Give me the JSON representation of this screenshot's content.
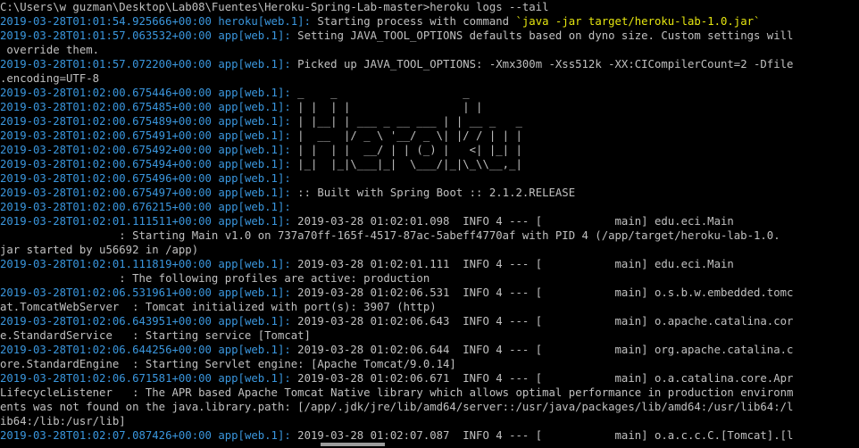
{
  "colors": {
    "background": "#000000",
    "text": "#c0c0c0",
    "timestamp": "#3a96dd",
    "highlight": "#e5e510"
  },
  "lines": [
    {
      "kind": "plain",
      "text": "C:\\Users\\w guzman\\Desktop\\Lab08\\Fuentes\\Heroku-Spring-Lab-master>heroku logs --tail"
    },
    {
      "kind": "log",
      "ts": "2019-03-28T01:01:54.925666+00:00",
      "src": " heroku[web.1]:",
      "msg": " Starting process with command ",
      "hl": "`java -jar target/heroku-lab-1.0.jar`"
    },
    {
      "kind": "log",
      "ts": "2019-03-28T01:01:57.063532+00:00",
      "src": " app[web.1]:",
      "msg": " Setting JAVA_TOOL_OPTIONS defaults based on dyno size. Custom settings will"
    },
    {
      "kind": "plain",
      "text": " override them."
    },
    {
      "kind": "log",
      "ts": "2019-03-28T01:01:57.072200+00:00",
      "src": " app[web.1]:",
      "msg": " Picked up JAVA_TOOL_OPTIONS: -Xmx300m -Xss512k -XX:CICompilerCount=2 -Dfile"
    },
    {
      "kind": "plain",
      "text": ".encoding=UTF-8"
    },
    {
      "kind": "log",
      "ts": "2019-03-28T01:02:00.675446+00:00",
      "src": " app[web.1]:",
      "msg": " _    _                   _"
    },
    {
      "kind": "log",
      "ts": "2019-03-28T01:02:00.675485+00:00",
      "src": " app[web.1]:",
      "msg": " | |  | |                 | |"
    },
    {
      "kind": "log",
      "ts": "2019-03-28T01:02:00.675489+00:00",
      "src": " app[web.1]:",
      "msg": " | |__| | ___ _ __ ___ | | __ _   _"
    },
    {
      "kind": "log",
      "ts": "2019-03-28T01:02:00.675491+00:00",
      "src": " app[web.1]:",
      "msg": " |  __  |/ _ \\ '__/ _ \\| |/ / | | |"
    },
    {
      "kind": "log",
      "ts": "2019-03-28T01:02:00.675492+00:00",
      "src": " app[web.1]:",
      "msg": " | |  | |  __/ | | (_) |   <| |_| |"
    },
    {
      "kind": "log",
      "ts": "2019-03-28T01:02:00.675494+00:00",
      "src": " app[web.1]:",
      "msg": " |_|  |_|\\___|_|  \\___/|_|\\_\\\\__,_|"
    },
    {
      "kind": "log",
      "ts": "2019-03-28T01:02:00.675496+00:00",
      "src": " app[web.1]:",
      "msg": ""
    },
    {
      "kind": "log",
      "ts": "2019-03-28T01:02:00.675497+00:00",
      "src": " app[web.1]:",
      "msg": " :: Built with Spring Boot :: 2.1.2.RELEASE"
    },
    {
      "kind": "log",
      "ts": "2019-03-28T01:02:00.676215+00:00",
      "src": " app[web.1]:",
      "msg": ""
    },
    {
      "kind": "log",
      "ts": "2019-03-28T01:02:01.111511+00:00",
      "src": " app[web.1]:",
      "msg": " 2019-03-28 01:02:01.098  INFO 4 --- [           main] edu.eci.Main"
    },
    {
      "kind": "plain",
      "text": "                  : Starting Main v1.0 on 737a70ff-165f-4517-87ac-5abeff4770af with PID 4 (/app/target/heroku-lab-1.0."
    },
    {
      "kind": "plain",
      "text": "jar started by u56692 in /app)"
    },
    {
      "kind": "log",
      "ts": "2019-03-28T01:02:01.111819+00:00",
      "src": " app[web.1]:",
      "msg": " 2019-03-28 01:02:01.111  INFO 4 --- [           main] edu.eci.Main"
    },
    {
      "kind": "plain",
      "text": "                  : The following profiles are active: production"
    },
    {
      "kind": "log",
      "ts": "2019-03-28T01:02:06.531961+00:00",
      "src": " app[web.1]:",
      "msg": " 2019-03-28 01:02:06.531  INFO 4 --- [           main] o.s.b.w.embedded.tomc"
    },
    {
      "kind": "plain",
      "text": "at.TomcatWebServer  : Tomcat initialized with port(s): 3907 (http)"
    },
    {
      "kind": "log",
      "ts": "2019-03-28T01:02:06.643951+00:00",
      "src": " app[web.1]:",
      "msg": " 2019-03-28 01:02:06.643  INFO 4 --- [           main] o.apache.catalina.cor"
    },
    {
      "kind": "plain",
      "text": "e.StandardService   : Starting service [Tomcat]"
    },
    {
      "kind": "log",
      "ts": "2019-03-28T01:02:06.644256+00:00",
      "src": " app[web.1]:",
      "msg": " 2019-03-28 01:02:06.644  INFO 4 --- [           main] org.apache.catalina.c"
    },
    {
      "kind": "plain",
      "text": "ore.StandardEngine  : Starting Servlet engine: [Apache Tomcat/9.0.14]"
    },
    {
      "kind": "log",
      "ts": "2019-03-28T01:02:06.671581+00:00",
      "src": " app[web.1]:",
      "msg": " 2019-03-28 01:02:06.671  INFO 4 --- [           main] o.a.catalina.core.Apr"
    },
    {
      "kind": "plain",
      "text": "LifecycleListener   : The APR based Apache Tomcat Native library which allows optimal performance in production environm"
    },
    {
      "kind": "plain",
      "text": "ents was not found on the java.library.path: [/app/.jdk/jre/lib/amd64/server::/usr/java/packages/lib/amd64:/usr/lib64:/l"
    },
    {
      "kind": "plain",
      "text": "ib64:/lib:/usr/lib]"
    },
    {
      "kind": "log",
      "ts": "2019-03-28T01:02:07.087426+00:00",
      "src": " app[web.1]:",
      "msg": " 2019-03-28 01:02:07.087  INFO 4 --- [           main] o.a.c.c.C.[Tomcat].[l"
    }
  ]
}
